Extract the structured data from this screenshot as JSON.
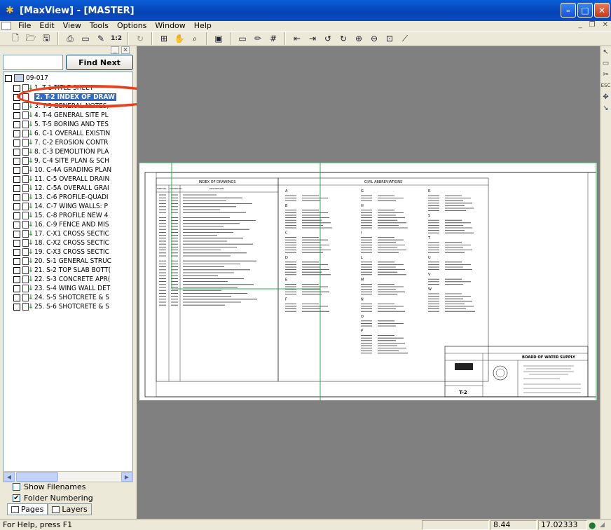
{
  "window": {
    "title": "[MaxView] - [MASTER]"
  },
  "menu": [
    "File",
    "Edit",
    "View",
    "Tools",
    "Options",
    "Window",
    "Help"
  ],
  "left_panel": {
    "find_value": "",
    "find_next_label": "Find Next",
    "root_label": "09-017",
    "selected_index": 1,
    "items": [
      "1. T-1 TITLE SHEET",
      "2. T-2 INDEX OF DRAW",
      "3. T-3 GENERAL NOTES,",
      "4. T-4 GENERAL SITE PL",
      "5. T-5 BORING AND TES",
      "6. C-1 OVERALL EXISTIN",
      "7. C-2 EROSION CONTR",
      "8. C-3 DEMOLITION PLA",
      "9. C-4 SITE PLAN & SCH",
      "10. C-4A GRADING PLAN",
      "11. C-5 OVERALL DRAIN",
      "12. C-5A OVERALL GRAI",
      "13. C-6 PROFILE-QUADI",
      "14. C-7 WING WALLS: P",
      "15. C-8 PROFILE NEW 4",
      "16. C-9 FENCE AND MIS",
      "17. C-X1 CROSS SECTIC",
      "18. C-X2 CROSS SECTIC",
      "19. C-X3 CROSS SECTIC",
      "20. S-1 GENERAL STRUC",
      "21. S-2 TOP SLAB BOTT(",
      "22. S-3 CONCRETE APR(",
      "23. S-4 WING WALL DET",
      "24. S-5 SHOTCRETE & S",
      "25. S-6 SHOTCRETE & S"
    ],
    "show_filenames_label": "Show Filenames",
    "show_filenames_checked": false,
    "folder_numbering_label": "Folder Numbering",
    "folder_numbering_checked": true,
    "tab_pages": "Pages",
    "tab_layers": "Layers"
  },
  "sheet": {
    "index_title": "INDEX OF DRAWINGS",
    "abbrev_title": "CIVIL ABBREVIATIONS",
    "index_col1": "SHEET NO.",
    "index_col2": "DRAWING NO.",
    "index_col3": "DESCRIPTION",
    "sheet_no": "T-2",
    "owner_title": "BOARD OF WATER SUPPLY",
    "letters": [
      "A",
      "B",
      "C",
      "D",
      "E",
      "F",
      "G",
      "H",
      "I",
      "L",
      "M",
      "N",
      "O",
      "P",
      "R",
      "S",
      "T",
      "U",
      "V",
      "W"
    ]
  },
  "status": {
    "text": "For Help, press F1",
    "value1": "8.44",
    "value2": "17.02333"
  },
  "colors": {
    "titlebar": "#0a4cc4",
    "selection": "#316ac5",
    "highlight_ellipse": "#e8401c",
    "doc_background": "#808080",
    "crop_line": "#2fa84f"
  }
}
